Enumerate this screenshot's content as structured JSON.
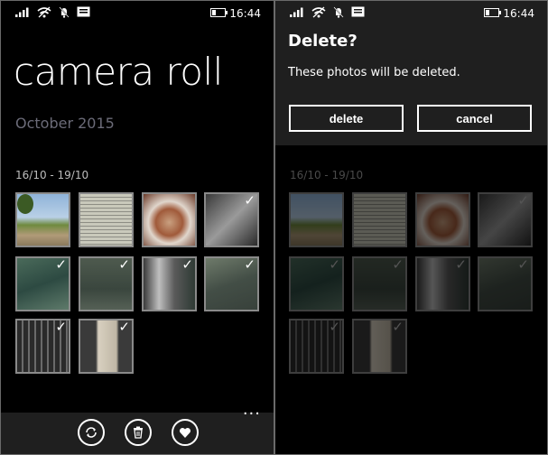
{
  "status": {
    "time": "16:44"
  },
  "left_screen": {
    "title": "camera roll",
    "month": "October 2015",
    "date_range": "16/10 - 19/10",
    "photos": [
      {
        "name": "tree-photo",
        "selected": false
      },
      {
        "name": "document-photo",
        "selected": false
      },
      {
        "name": "food-photo",
        "selected": false
      },
      {
        "name": "glass-photo",
        "selected": true
      },
      {
        "name": "room-photo",
        "selected": true
      },
      {
        "name": "floor-photo",
        "selected": true
      },
      {
        "name": "window-photo",
        "selected": true
      },
      {
        "name": "carpet-photo",
        "selected": true
      },
      {
        "name": "keyboard-photo",
        "selected": true
      },
      {
        "name": "cup-photo",
        "selected": true
      }
    ],
    "app_bar": {
      "icons": [
        "sync-icon",
        "delete-icon",
        "favorite-icon"
      ],
      "more": "..."
    }
  },
  "right_screen": {
    "dialog": {
      "title": "Delete?",
      "message": "These photos will be deleted.",
      "delete_label": "delete",
      "cancel_label": "cancel"
    },
    "date_range": "16/10 - 19/10"
  }
}
